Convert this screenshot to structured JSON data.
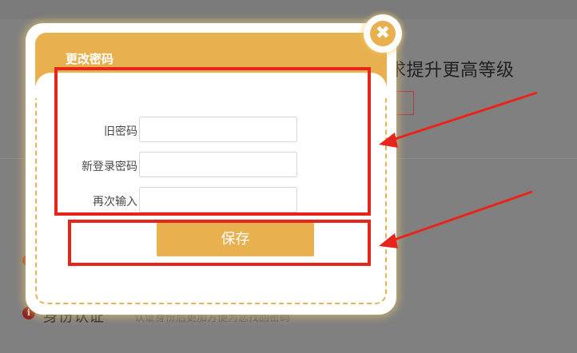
{
  "background": {
    "heading": "求提升更高等级",
    "section_title": "身份认证",
    "section_desc": "认证身份后更加方便为您找回密码",
    "info_icon": "i"
  },
  "modal": {
    "title": "更改密码",
    "close_glyph": "✖",
    "fields": [
      {
        "label": "旧密码",
        "value": ""
      },
      {
        "label": "新登录密码",
        "value": ""
      },
      {
        "label": "再次输入",
        "value": ""
      }
    ],
    "save_label": "保存"
  },
  "colors": {
    "accent": "#e8b04f",
    "annotation_red": "#e8251a",
    "overlay": "#808080"
  }
}
